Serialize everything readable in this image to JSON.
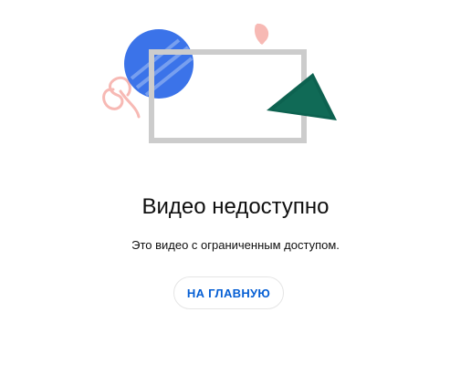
{
  "message": {
    "title": "Видео недоступно",
    "subtitle": "Это видео с ограниченным доступом."
  },
  "actions": {
    "home_label": "НА ГЛАВНУЮ"
  },
  "colors": {
    "accent_blue": "#065fd4",
    "circle_blue": "#3b73e9",
    "triangle_green": "#0d6250",
    "pink": "#f7b9b4",
    "frame_gray": "#cccccc"
  }
}
